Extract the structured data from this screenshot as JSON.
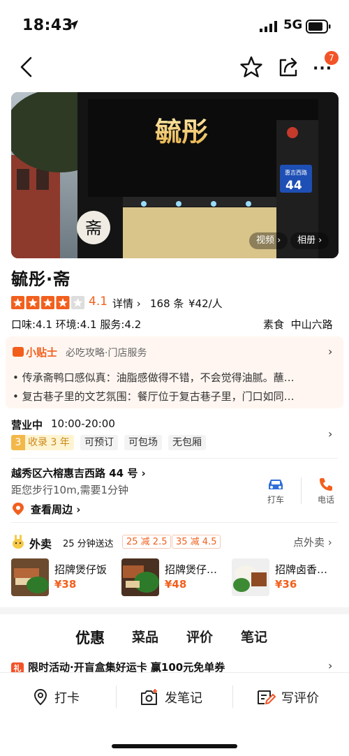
{
  "status_bar": {
    "time": "18:43",
    "network": "5G"
  },
  "nav": {
    "more_badge": "7"
  },
  "hero": {
    "video_label": "视频",
    "album_label": "相册",
    "sign_text": "毓彤",
    "door_number": "44",
    "seal_text": "斋"
  },
  "shop": {
    "name": "毓彤·斋",
    "rating": "4.1",
    "rating_value": 4.1,
    "detail_label": "详情",
    "review_count": "168 条",
    "avg_price": "¥42/人",
    "sub_scores": "口味:4.1 环境:4.1 服务:4.2",
    "category": "素食",
    "area": "中山六路"
  },
  "tips": {
    "heading": "小贴士",
    "subtitle": "必吃攻略·门店服务",
    "items": [
      "传承斋鸭口感似真：油脂感做得不错，不会觉得油腻。蘸…",
      "复古巷子里的文艺氛围：餐厅位于复古巷子里，门口如同…"
    ]
  },
  "hours": {
    "status": "营业中",
    "time": "10:00-20:00",
    "rank_num": "3",
    "tags": [
      "收录 3 年",
      "可预订",
      "可包场",
      "无包厢"
    ]
  },
  "location": {
    "address": "越秀区六榕惠吉西路 44 号",
    "walk": "距您步行10m,需要1分钟",
    "around_label": "查看周边",
    "taxi_label": "打车",
    "phone_label": "电话"
  },
  "takeout": {
    "title": "外卖",
    "delivery": "25 分钟送达",
    "discounts": [
      "25 减 2.5",
      "35 减 4.5"
    ],
    "more_label": "点外卖",
    "dishes": [
      {
        "name": "招牌煲仔饭",
        "price": "¥38"
      },
      {
        "name": "招牌煲仔…",
        "price": "¥48"
      },
      {
        "name": "招牌卤香…",
        "price": "¥36"
      }
    ]
  },
  "tabs": [
    "优惠",
    "菜品",
    "评价",
    "笔记"
  ],
  "promo": {
    "icon": "礼",
    "text": "限时活动·开盲盒集好运卡 赢100元免单券"
  },
  "bottom_bar": {
    "checkin": "打卡",
    "note": "发笔记",
    "review": "写评价"
  },
  "colors": {
    "accent": "#f25f1d",
    "star": "#f5a623",
    "taxi_icon": "#2f6fd8"
  }
}
